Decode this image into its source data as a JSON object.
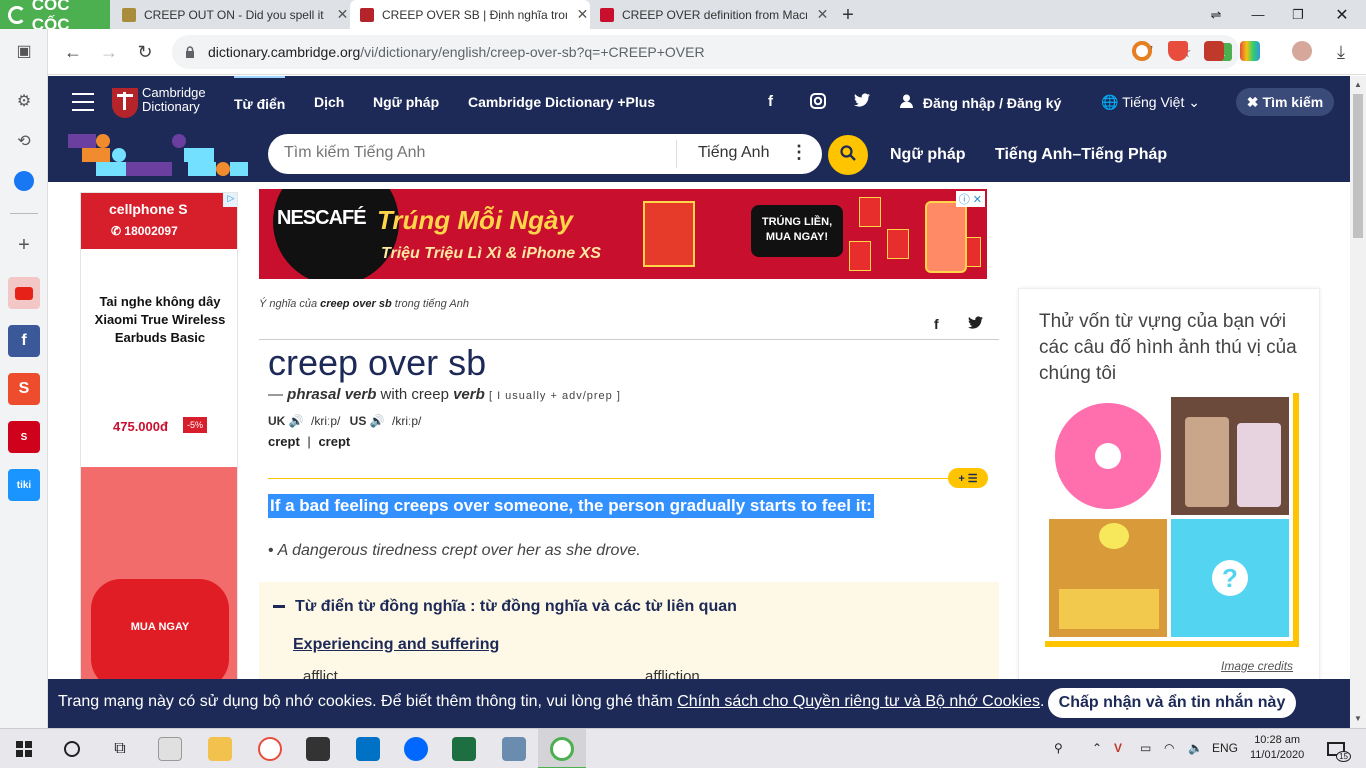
{
  "browser": {
    "logo": "CỐC CỐC",
    "tabs": [
      {
        "title": "CREEP OUT ON - Did you spell it c",
        "active": false
      },
      {
        "title": "CREEP OVER SB | Định nghĩa trong",
        "active": true
      },
      {
        "title": "CREEP OVER definition from Macm",
        "active": false
      }
    ],
    "url_domain": "dictionary.cambridge.org",
    "url_path": "/vi/dictionary/english/creep-over-sb?q=+CREEP+OVER"
  },
  "header": {
    "logo_line1": "Cambridge",
    "logo_line2": "Dictionary",
    "nav": [
      "Từ điển",
      "Dịch",
      "Ngữ pháp",
      "Cambridge Dictionary +Plus"
    ],
    "login": "Đăng nhập / Đăng ký",
    "language": "Tiếng Việt",
    "search_toggle": "Tìm kiếm"
  },
  "search": {
    "placeholder": "Tìm kiếm Tiếng Anh",
    "dictionary": "Tiếng Anh",
    "links": [
      "Ngữ pháp",
      "Tiếng Anh–Tiếng Pháp"
    ]
  },
  "left_ad": {
    "brand": "cellphone S",
    "phone": "18002097",
    "title": "Tai nghe không dây Xiaomi True Wireless Earbuds Basic",
    "price": "475.000đ",
    "discount": "-5%",
    "cta": "MUA NGAY"
  },
  "banner": {
    "brand": "NESCAFÉ",
    "headline": "Trúng Mỗi Ngày",
    "subline": "Triệu Triệu Lì Xì & iPhone XS",
    "cta_line1": "TRÚNG LIỀN,",
    "cta_line2": "MUA NGAY!"
  },
  "entry": {
    "meaning_prefix": "Ý nghĩa của ",
    "meaning_word": "creep over sb",
    "meaning_suffix": " trong tiếng Anh",
    "headword": "creep over sb",
    "pos_dash": "— ",
    "pos": "phrasal verb",
    "with_text": " with creep ",
    "verb": "verb",
    "grammar": "[ I usually + adv/prep ]",
    "uk_label": "UK",
    "uk_ipa": "/kriːp/",
    "us_label": "US",
    "us_ipa": "/kriːp/",
    "form1": "crept",
    "form_sep": "|",
    "form2": "crept",
    "definition": "If a bad feeling creeps over someone, the person gradually starts to feel it:",
    "example": "A dangerous tiredness crept over her as she drove.",
    "example_bullet": "•"
  },
  "thesaurus": {
    "title": "Từ điển từ đồng nghĩa : từ đồng nghĩa và các từ liên quan",
    "subtitle": "Experiencing and suffering",
    "words": [
      "afflict",
      "affliction"
    ]
  },
  "quiz": {
    "text": "Thử vốn từ vựng của bạn với các câu đố hình ảnh thú vị của chúng tôi",
    "credits": "Image credits"
  },
  "cookie": {
    "text": "Trang mạng này có sử dụng bộ nhớ cookies. Để biết thêm thông tin, vui lòng ghé thăm ",
    "link": "Chính sách cho Quyền riêng tư và Bộ nhớ Cookies",
    "period": ".",
    "button": "Chấp nhận và ẩn tin nhắn này"
  },
  "taskbar": {
    "language": "ENG",
    "time": "10:28 am",
    "date": "11/01/2020",
    "notifications": "15"
  },
  "colors": {
    "cambridge_navy": "#1d2a57",
    "cambridge_yellow": "#fec400",
    "selection_blue": "#3390ff",
    "coccoc_green": "#4caf50"
  }
}
